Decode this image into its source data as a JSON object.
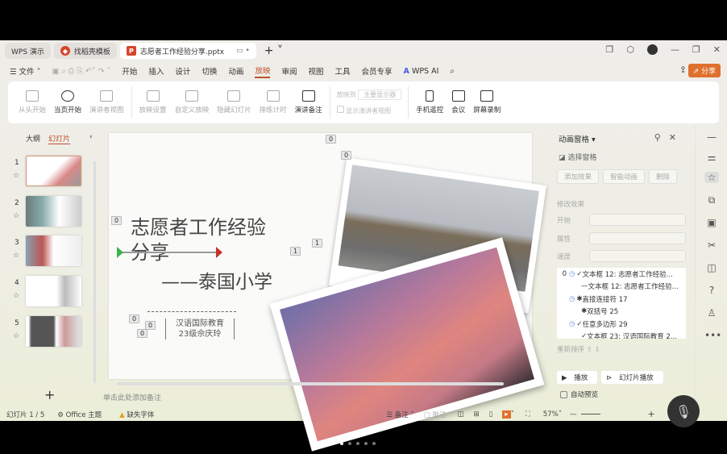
{
  "tabs": [
    {
      "label": "WPS 演示"
    },
    {
      "label": "找稻壳模板"
    },
    {
      "label": "志愿者工作经验分享.pptx"
    }
  ],
  "menu": {
    "file": "文件",
    "items": [
      "开始",
      "插入",
      "设计",
      "切换",
      "动画",
      "放映",
      "审阅",
      "视图",
      "工具",
      "会员专享"
    ],
    "active": "放映",
    "ai": "WPS AI",
    "share": "分享"
  },
  "ribbon": {
    "buttons": [
      "从头开始",
      "当页开始",
      "演讲者视图",
      "放映设置",
      "自定义放映",
      "隐藏幻灯片",
      "排练计时",
      "演讲备注"
    ],
    "display_label": "放映到",
    "display_value": "主要显示器",
    "show_presenter": "显示演讲者视图",
    "buttons2": [
      "手机遥控",
      "会议",
      "屏幕录制"
    ]
  },
  "left": {
    "outline": "大纲",
    "slides": "幻灯片",
    "count": [
      "1",
      "2",
      "3",
      "4",
      "5"
    ]
  },
  "slide": {
    "title1": "志愿者工作经验",
    "title2": "分享",
    "subtitle": "——泰国小学",
    "name1": "汉语国际教育",
    "name2": "23级佘庆玲",
    "badges": [
      "0",
      "0",
      "0",
      "1",
      "1",
      "0",
      "0",
      "0"
    ]
  },
  "notes": "单击此处添加备注",
  "anim": {
    "title": "动画窗格",
    "select": "选择窗格",
    "add": "添加效果",
    "smart": "智能动画",
    "del": "删除",
    "modify": "修改效果",
    "start": "开始",
    "prop": "属性",
    "speed": "速度",
    "items": [
      {
        "n": "0",
        "t": "文本框 12: 志愿者工作经验..."
      },
      {
        "n": "",
        "t": "文本框 12: 志愿者工作经验..."
      },
      {
        "n": "",
        "t": "直接连接符 17"
      },
      {
        "n": "",
        "t": "双括号 25"
      },
      {
        "n": "",
        "t": "任意多边形 29"
      },
      {
        "n": "",
        "t": "文本框 23: 汉语国际教育 2..."
      }
    ],
    "reorder": "重新排序",
    "play": "播放",
    "slideshow": "幻灯片播放",
    "autopreview": "自动预览"
  },
  "status": {
    "slide": "幻灯片 1 / 5",
    "theme": "Office 主题",
    "font": "缺失字体",
    "notes": "备注",
    "comment": "批注",
    "zoom": "57%"
  },
  "colors": {
    "accent": "#c0502a",
    "share": "#e0702e"
  }
}
